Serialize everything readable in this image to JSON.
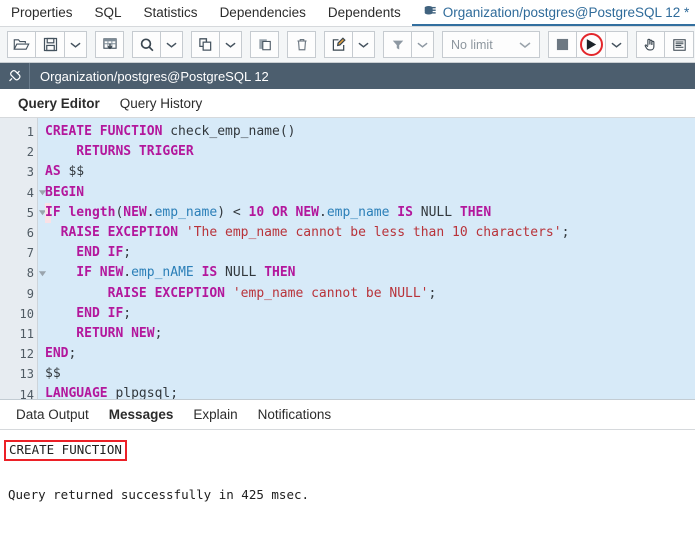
{
  "object_tabs": [
    {
      "label": "Properties",
      "active": false,
      "icon": null
    },
    {
      "label": "SQL",
      "active": false,
      "icon": null
    },
    {
      "label": "Statistics",
      "active": false,
      "icon": null
    },
    {
      "label": "Dependencies",
      "active": false,
      "icon": null
    },
    {
      "label": "Dependents",
      "active": false,
      "icon": null
    },
    {
      "label": "Organization/postgres@PostgreSQL 12 *",
      "active": true,
      "icon": "database-server-icon"
    }
  ],
  "toolbar": {
    "groups": [
      {
        "items": [
          {
            "name": "open-file-icon",
            "title": "Open File"
          },
          {
            "name": "save-file-icon",
            "title": "Save File"
          },
          {
            "name": "chevron-down-icon",
            "title": "Save options"
          }
        ]
      },
      {
        "items": [
          {
            "name": "edit-grid-icon",
            "title": "Edit grid"
          }
        ]
      },
      {
        "items": [
          {
            "name": "search-icon",
            "title": "Find"
          },
          {
            "name": "chevron-down-icon",
            "title": "Find options"
          }
        ]
      },
      {
        "items": [
          {
            "name": "copy-icon",
            "title": "Copy"
          },
          {
            "name": "chevron-down-icon",
            "title": "Copy options"
          }
        ]
      },
      {
        "items": [
          {
            "name": "paste-icon",
            "title": "Paste"
          }
        ]
      },
      {
        "items": [
          {
            "name": "trash-icon",
            "title": "Delete"
          }
        ]
      },
      {
        "items": [
          {
            "name": "edit-pencil-icon",
            "title": "Edit"
          },
          {
            "name": "chevron-down-icon",
            "title": "Edit options"
          }
        ]
      },
      {
        "items": [
          {
            "name": "filter-funnel-icon",
            "title": "Filter"
          },
          {
            "name": "chevron-down-icon",
            "title": "Filter options"
          }
        ]
      },
      {
        "items": [
          {
            "name": "row-limit-select",
            "title": "Row limit"
          }
        ]
      },
      {
        "items": [
          {
            "name": "stop-icon",
            "title": "Stop"
          },
          {
            "name": "execute-play-icon",
            "title": "Execute/Refresh"
          },
          {
            "name": "chevron-down-icon",
            "title": "Execute options"
          }
        ]
      },
      {
        "items": [
          {
            "name": "explain-hand-icon",
            "title": "Explain"
          },
          {
            "name": "query-tool-icon",
            "title": "Query tool"
          }
        ]
      }
    ],
    "row_limit_label": "No limit",
    "run_button_highlight_color": "#e3262b"
  },
  "connection_bar": {
    "icon": "connection-plug-icon",
    "title": "Organization/postgres@PostgreSQL 12"
  },
  "query_tabs": [
    {
      "label": "Query Editor",
      "active": true
    },
    {
      "label": "Query History",
      "active": false
    }
  ],
  "editor": {
    "background_color": "#d7eaf8",
    "gutter_color": "#e7ecf1",
    "marker_color": "#fae1e6",
    "lines": [
      {
        "number": 1,
        "fold": false,
        "marked": false,
        "tokens": [
          {
            "t": "CREATE FUNCTION",
            "c": "kw"
          },
          {
            "t": " check_emp_name",
            "c": "plain"
          },
          {
            "t": "()",
            "c": "punc"
          }
        ]
      },
      {
        "number": 2,
        "fold": false,
        "marked": false,
        "tokens": [
          {
            "t": "    RETURNS TRIGGER",
            "c": "kw"
          }
        ]
      },
      {
        "number": 3,
        "fold": false,
        "marked": false,
        "tokens": [
          {
            "t": "AS",
            "c": "kw"
          },
          {
            "t": " $$",
            "c": "plain"
          }
        ]
      },
      {
        "number": 4,
        "fold": true,
        "marked": false,
        "tokens": [
          {
            "t": "BEGIN",
            "c": "kw"
          }
        ]
      },
      {
        "number": 5,
        "fold": true,
        "marked": true,
        "tokens": [
          {
            "t": "IF length",
            "c": "kw"
          },
          {
            "t": "(",
            "c": "punc"
          },
          {
            "t": "NEW",
            "c": "kw"
          },
          {
            "t": ".",
            "c": "punc"
          },
          {
            "t": "emp_name",
            "c": "ident"
          },
          {
            "t": ")",
            "c": "punc"
          },
          {
            "t": " < ",
            "c": "punc"
          },
          {
            "t": "10",
            "c": "num"
          },
          {
            "t": " ",
            "c": "plain"
          },
          {
            "t": "OR",
            "c": "kw"
          },
          {
            "t": " ",
            "c": "plain"
          },
          {
            "t": "NEW",
            "c": "kw"
          },
          {
            "t": ".",
            "c": "punc"
          },
          {
            "t": "emp_name",
            "c": "ident"
          },
          {
            "t": " ",
            "c": "plain"
          },
          {
            "t": "IS",
            "c": "kw"
          },
          {
            "t": " NULL ",
            "c": "plain"
          },
          {
            "t": "THEN",
            "c": "kw"
          }
        ]
      },
      {
        "number": 6,
        "fold": false,
        "marked": false,
        "tokens": [
          {
            "t": "  RAISE EXCEPTION",
            "c": "kw"
          },
          {
            "t": " ",
            "c": "plain"
          },
          {
            "t": "'The emp_name cannot be less than 10 characters'",
            "c": "str"
          },
          {
            "t": ";",
            "c": "punc"
          }
        ]
      },
      {
        "number": 7,
        "fold": false,
        "marked": false,
        "tokens": [
          {
            "t": "    END IF",
            "c": "kw"
          },
          {
            "t": ";",
            "c": "punc"
          }
        ]
      },
      {
        "number": 8,
        "fold": true,
        "marked": false,
        "tokens": [
          {
            "t": "    IF",
            "c": "kw"
          },
          {
            "t": " ",
            "c": "plain"
          },
          {
            "t": "NEW",
            "c": "kw"
          },
          {
            "t": ".",
            "c": "punc"
          },
          {
            "t": "emp_nAME",
            "c": "ident"
          },
          {
            "t": " ",
            "c": "plain"
          },
          {
            "t": "IS",
            "c": "kw"
          },
          {
            "t": " NULL ",
            "c": "plain"
          },
          {
            "t": "THEN",
            "c": "kw"
          }
        ]
      },
      {
        "number": 9,
        "fold": false,
        "marked": false,
        "tokens": [
          {
            "t": "        RAISE EXCEPTION",
            "c": "kw"
          },
          {
            "t": " ",
            "c": "plain"
          },
          {
            "t": "'emp_name cannot be NULL'",
            "c": "str"
          },
          {
            "t": ";",
            "c": "punc"
          }
        ]
      },
      {
        "number": 10,
        "fold": false,
        "marked": false,
        "tokens": [
          {
            "t": "    END IF",
            "c": "kw"
          },
          {
            "t": ";",
            "c": "punc"
          }
        ]
      },
      {
        "number": 11,
        "fold": false,
        "marked": false,
        "tokens": [
          {
            "t": "    RETURN NEW",
            "c": "kw"
          },
          {
            "t": ";",
            "c": "punc"
          }
        ]
      },
      {
        "number": 12,
        "fold": false,
        "marked": false,
        "tokens": [
          {
            "t": "END",
            "c": "kw"
          },
          {
            "t": ";",
            "c": "punc"
          }
        ]
      },
      {
        "number": 13,
        "fold": false,
        "marked": false,
        "tokens": [
          {
            "t": "$$",
            "c": "plain"
          }
        ]
      },
      {
        "number": 14,
        "fold": false,
        "marked": false,
        "tokens": [
          {
            "t": "LANGUAGE",
            "c": "kw"
          },
          {
            "t": " plpgsql",
            "c": "plain"
          },
          {
            "t": ";",
            "c": "punc"
          }
        ]
      }
    ]
  },
  "bottom_tabs": [
    {
      "label": "Data Output",
      "active": false
    },
    {
      "label": "Messages",
      "active": true
    },
    {
      "label": "Explain",
      "active": false
    },
    {
      "label": "Notifications",
      "active": false
    }
  ],
  "messages": {
    "result_label": "CREATE FUNCTION",
    "result_highlight_color": "#ec2027",
    "status_text": "Query returned successfully in 425 msec."
  }
}
